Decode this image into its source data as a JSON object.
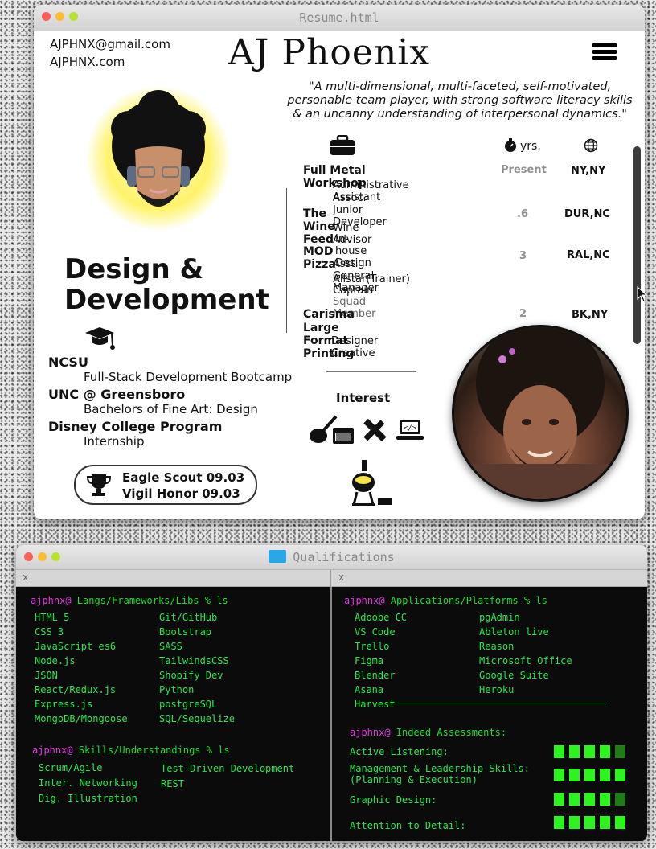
{
  "resume_window": {
    "title": "Resume.html",
    "email": "AJPHNX@gmail.com",
    "website": "AJPHNX.com",
    "name": "AJ Phoenix",
    "quote": "\"A multi-dimensional, multi-faceted, self-motivated, personable team player, with strong software literacy skills & an uncanny understanding of interpersonal dynamics.\"",
    "role_line1": "Design &",
    "role_line2": "Development",
    "header_years_label": "yrs.",
    "education": [
      {
        "school": "NCSU",
        "program": "Full-Stack Development Bootcamp"
      },
      {
        "school": "UNC @ Greensboro",
        "program": "Bachelors of Fine Art: Design"
      },
      {
        "school": "Disney College Program",
        "program": "Internship"
      }
    ],
    "awards": [
      "Eagle Scout 09.03",
      "Vigil Honor 09.03"
    ],
    "work": [
      {
        "company": "Full Metal Workshop",
        "years": "Present",
        "location": "NY,NY",
        "roles": [
          "Administrative Assistant",
          "Assoc. Junior Developer"
        ]
      },
      {
        "company": "The Wine Feed",
        "years": ".6",
        "location": "DUR,NC",
        "roles": [
          "Wine Advisor",
          "In-house Design"
        ]
      },
      {
        "company": "MOD Pizza",
        "years": "3",
        "location": "RAL,NC",
        "roles": [
          "Asst. General Manager",
          "Allstar(Trainer)",
          "Captain",
          "Squad Member"
        ]
      },
      {
        "company": "Carisma",
        "years": "2",
        "location": "BK,NY",
        "roles": []
      },
      {
        "company": "Large Format Printing",
        "years": "",
        "location": "",
        "roles": [
          "Designer",
          "Creative"
        ]
      }
    ],
    "interest_title": "Interest"
  },
  "qualifications_window": {
    "title": "Qualifications",
    "tab_close": "x",
    "left_pane": {
      "prompt1_user": "ajphnx@",
      "prompt1_path": " Langs/Frameworks/Libs % ls",
      "langs_col1": [
        "HTML 5",
        "CSS 3",
        "JavaScript es6",
        "Node.js",
        "JSON",
        "React/Redux.js",
        "Express.js",
        "MongoDB/Mongoose"
      ],
      "langs_col2": [
        "Git/GitHub",
        "Bootstrap",
        "SASS",
        "TailwindsCSS",
        "Shopify Dev",
        "Python",
        "postgreSQL",
        "SQL/Sequelize"
      ],
      "prompt2_user": "ajphnx@",
      "prompt2_path": " Skills/Understandings % ls",
      "skills_col1": [
        "Scrum/Agile",
        "Inter. Networking",
        "Dig. Illustration"
      ],
      "skills_col2": [
        "Test-Driven Development",
        "REST"
      ]
    },
    "right_pane": {
      "prompt1_user": "ajphnx@",
      "prompt1_path": " Applications/Platforms % ls",
      "apps_col1": [
        "Adoobe CC",
        "VS Code",
        "Trello",
        "Figma",
        "Blender",
        "Asana",
        "Harvest"
      ],
      "apps_col2": [
        "pgAdmin",
        "Ableton live",
        "Reason",
        "Microsoft Office",
        "Google Suite",
        "Heroku"
      ],
      "assess_user": "ajphnx@",
      "assess_title": " Indeed Assessments:",
      "assessments": [
        {
          "label": "Active Listening:",
          "level": 4.5
        },
        {
          "label": "Management & Leadership Skills:\n(Planning & Execution)",
          "level": 5
        },
        {
          "label": "Graphic Design:",
          "level": 4.5
        },
        {
          "label": "Attention to Detail:",
          "level": 5
        }
      ]
    }
  },
  "colors": {
    "terminal_green": "#25e84a",
    "prompt_magenta": "#e03ae0",
    "rating_dim": "#1f7d17",
    "rating_full": "#2cf51e"
  }
}
